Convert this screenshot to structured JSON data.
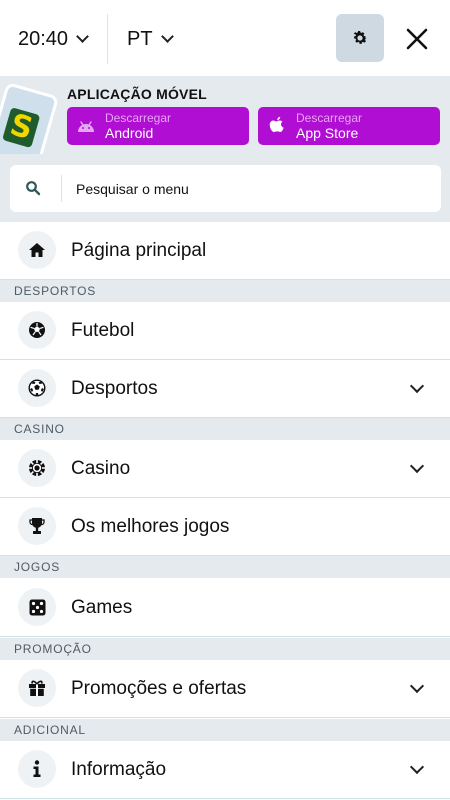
{
  "header": {
    "time": "20:40",
    "language": "PT"
  },
  "app_banner": {
    "title": "APLICAÇÃO MÓVEL",
    "logo_letter": "S",
    "android": {
      "top_label": "Descarregar",
      "bottom_label": "Android"
    },
    "ios": {
      "top_label": "Descarregar",
      "bottom_label": "App Store"
    }
  },
  "search": {
    "placeholder": "Pesquisar o menu",
    "value": ""
  },
  "menu": {
    "home": {
      "label": "Página principal",
      "icon": "home-icon"
    },
    "sections": {
      "sports": "DESPORTOS",
      "casino": "CASINO",
      "games": "JOGOS",
      "promo": "PROMOÇÃO",
      "extra": "ADICIONAL"
    },
    "items": {
      "football": {
        "label": "Futebol",
        "icon": "soccer-ball-icon"
      },
      "sports": {
        "label": "Desportos",
        "icon": "soccer-ball-icon"
      },
      "casino": {
        "label": "Casino",
        "icon": "chip-icon"
      },
      "top_games": {
        "label": "Os melhores jogos",
        "icon": "trophy-icon"
      },
      "games": {
        "label": "Games",
        "icon": "dice-icon"
      },
      "promotions": {
        "label": "Promoções e ofertas",
        "icon": "gift-icon"
      },
      "info": {
        "label": "Informação",
        "icon": "info-icon"
      }
    }
  },
  "colors": {
    "accent_purple": "#b10ed4",
    "panel_gray": "#e5eaee",
    "settings_bg": "#cfd9e2"
  }
}
